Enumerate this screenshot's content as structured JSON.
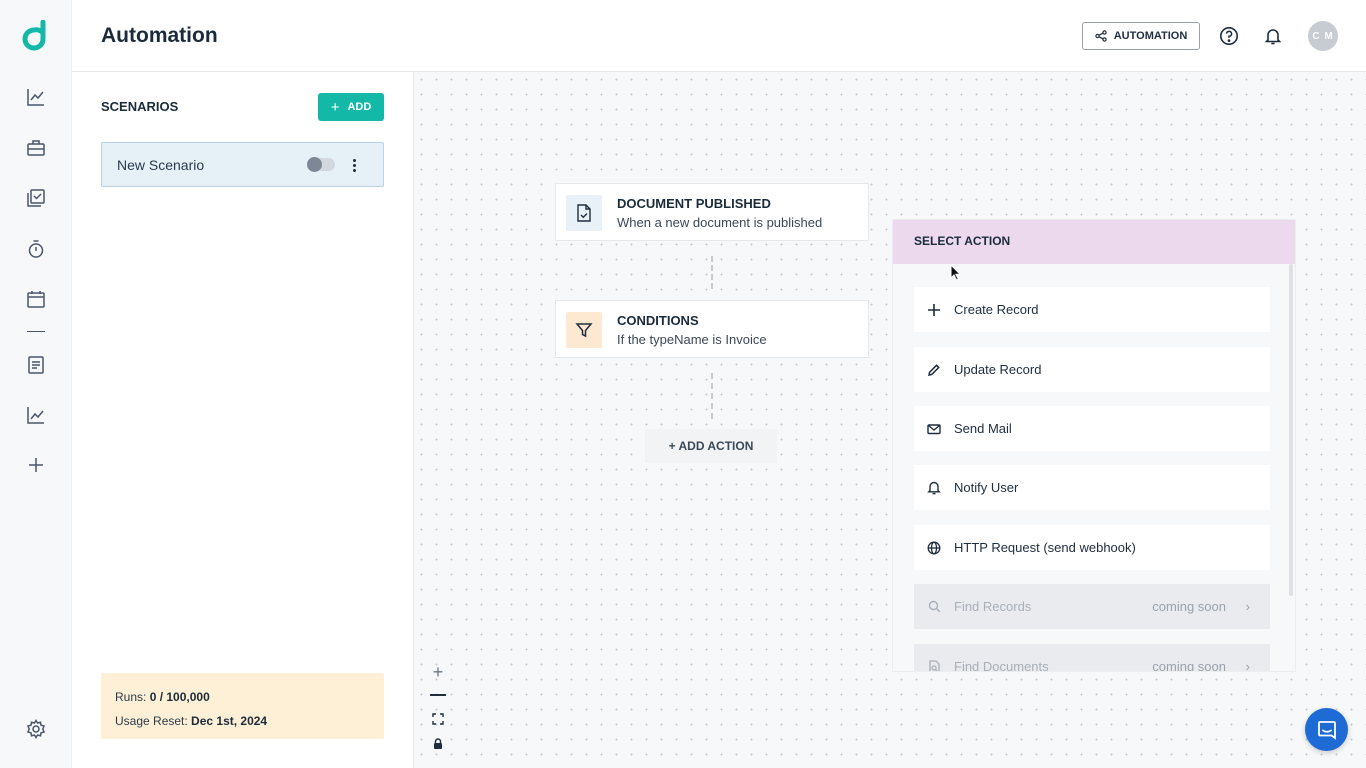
{
  "header": {
    "title": "Automation",
    "automation_button_label": "AUTOMATION",
    "avatar_initials": "C M"
  },
  "sidebar": {
    "icons": [
      "dashboard-chart-icon",
      "briefcase-icon",
      "checklist-icon",
      "stopwatch-icon",
      "calendar-icon",
      "document-icon",
      "analytics-icon",
      "plus-icon",
      "settings-gear-icon"
    ]
  },
  "scenarios": {
    "title": "SCENARIOS",
    "add_label": "ADD",
    "items": [
      {
        "name": "New Scenario",
        "enabled": false
      }
    ],
    "usage": {
      "runs_label": "Runs:",
      "runs_value": "0 / 100,000",
      "reset_label": "Usage Reset:",
      "reset_value": "Dec 1st, 2024"
    }
  },
  "canvas": {
    "nodes": [
      {
        "title": "DOCUMENT PUBLISHED",
        "subtitle": "When a new document is published",
        "icon": "document-check-icon",
        "icon_bg": "#e8f1f8"
      },
      {
        "title": "CONDITIONS",
        "subtitle": "If the typeName is Invoice",
        "icon": "filter-icon",
        "icon_bg": "#fde9d2"
      }
    ],
    "add_action_label": "+ ADD ACTION"
  },
  "select_action": {
    "title": "SELECT ACTION",
    "items": [
      {
        "label": "Create Record",
        "icon": "plus-icon",
        "available": true
      },
      {
        "label": "Update Record",
        "icon": "pencil-icon",
        "available": true
      },
      {
        "label": "Send Mail",
        "icon": "mail-icon",
        "available": true
      },
      {
        "label": "Notify User",
        "icon": "bell-icon",
        "available": true
      },
      {
        "label": "HTTP Request (send webhook)",
        "icon": "globe-icon",
        "available": true
      },
      {
        "label": "Find Records",
        "icon": "search-icon",
        "available": false,
        "badge": "coming soon"
      },
      {
        "label": "Find Documents",
        "icon": "document-search-icon",
        "available": false,
        "badge": "coming soon"
      }
    ]
  },
  "colors": {
    "accent": "#13b8a6",
    "logo": "#13b8a6",
    "popover_header": "#edd9ee",
    "usage_bg": "#fdf0d6",
    "chat_button": "#1e6bd6"
  }
}
